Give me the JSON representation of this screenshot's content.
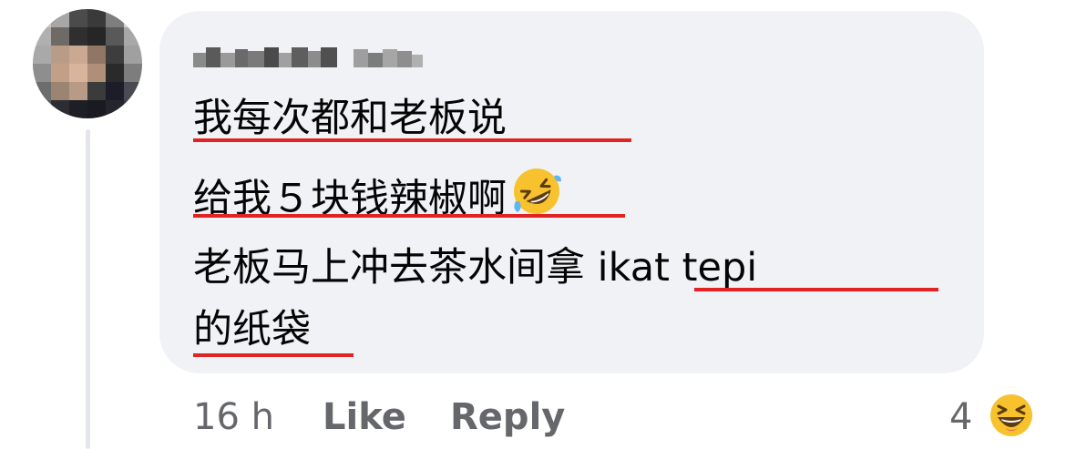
{
  "comment": {
    "author_blurred": true,
    "lines": [
      "我每次都和老板说",
      "给我５块钱辣椒啊",
      "老板马上冲去茶水间拿 ikat tepi",
      "的纸袋"
    ],
    "inline_emoji": "rolling-on-floor-laughing-emoji"
  },
  "actions": {
    "time": "16 h",
    "like_label": "Like",
    "reply_label": "Reply"
  },
  "reactions": {
    "count": "4",
    "emoji": "laughing-reaction-icon"
  },
  "colors": {
    "bubble": "#f0f2f5",
    "underline": "#e02424",
    "meta_text": "#65676b",
    "text": "#050505"
  }
}
